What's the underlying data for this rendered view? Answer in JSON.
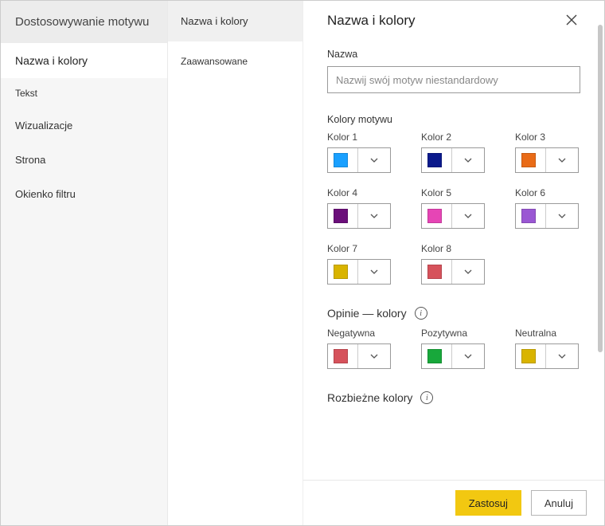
{
  "sidebar1": {
    "title": "Dostosowywanie motywu",
    "items": [
      {
        "label": "Nazwa i kolory",
        "active": true
      },
      {
        "label": "Tekst",
        "active": false
      },
      {
        "label": "Wizualizacje",
        "active": false
      },
      {
        "label": "Strona",
        "active": false
      },
      {
        "label": "Okienko filtru",
        "active": false
      }
    ]
  },
  "sidebar2": {
    "items": [
      {
        "label": "Nazwa i kolory",
        "active": true
      },
      {
        "label": "Zaawansowane",
        "active": false
      }
    ]
  },
  "main": {
    "title": "Nazwa i kolory",
    "name_section_label": "Nazwa",
    "name_placeholder": "Nazwij swój motyw niestandardowy",
    "theme_colors_label": "Kolory motywu",
    "colors": [
      {
        "label": "Kolor 1",
        "hex": "#1aa0ff"
      },
      {
        "label": "Kolor 2",
        "hex": "#0b1a8c"
      },
      {
        "label": "Kolor 3",
        "hex": "#e96b17"
      },
      {
        "label": "Kolor 4",
        "hex": "#6b0f7a"
      },
      {
        "label": "Kolor 5",
        "hex": "#e645b5"
      },
      {
        "label": "Kolor 6",
        "hex": "#9a57d3"
      },
      {
        "label": "Kolor 7",
        "hex": "#d9b400"
      },
      {
        "label": "Kolor 8",
        "hex": "#d6525b"
      }
    ],
    "feedback_heading": "Opinie — kolory",
    "feedback": [
      {
        "label": "Negatywna",
        "hex": "#d6525b"
      },
      {
        "label": "Pozytywna",
        "hex": "#18a83b"
      },
      {
        "label": "Neutralna",
        "hex": "#d9b400"
      }
    ],
    "divergent_heading": "Rozbieżne kolory"
  },
  "footer": {
    "apply": "Zastosuj",
    "cancel": "Anuluj"
  }
}
